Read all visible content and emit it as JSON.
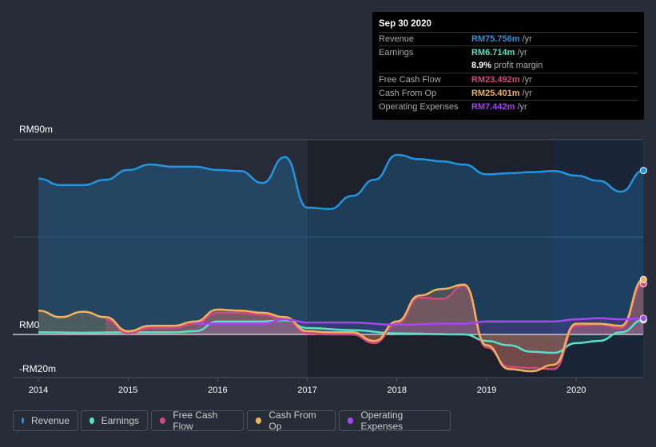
{
  "tooltip": {
    "date": "Sep 30 2020",
    "rows": [
      {
        "label": "Revenue",
        "value": "RM75.756m",
        "unit": "/yr",
        "color": "#2394df"
      },
      {
        "label": "Earnings",
        "value": "RM6.714m",
        "unit": "/yr",
        "color": "#58e0c5"
      },
      {
        "label": "",
        "value": "8.9%",
        "unit": "profit margin",
        "color": "#ffffff"
      },
      {
        "label": "Free Cash Flow",
        "value": "RM23.492m",
        "unit": "/yr",
        "color": "#d2487e"
      },
      {
        "label": "Cash From Op",
        "value": "RM25.401m",
        "unit": "/yr",
        "color": "#f2b25c"
      },
      {
        "label": "Operating Expenses",
        "value": "RM7.442m",
        "unit": "/yr",
        "color": "#a546f0"
      }
    ]
  },
  "chart_data": {
    "type": "line",
    "ylim": [
      -20,
      90
    ],
    "xlim": [
      2013.7,
      2020.75
    ],
    "y_tick_labels": [
      "RM90m",
      "RM0",
      "-RM20m"
    ],
    "x_tick_labels": [
      "2014",
      "2015",
      "2016",
      "2017",
      "2018",
      "2019",
      "2020"
    ],
    "x_ticks": [
      2014,
      2015,
      2016,
      2017,
      2018,
      2019,
      2020
    ],
    "grid": true,
    "legend_position": "bottom-left",
    "series": [
      {
        "name": "Revenue",
        "color": "#2394df",
        "x": [
          2014,
          2014.25,
          2014.5,
          2014.75,
          2015,
          2015.25,
          2015.5,
          2015.75,
          2016,
          2016.25,
          2016.5,
          2016.75,
          2017,
          2017.25,
          2017.5,
          2017.75,
          2018,
          2018.25,
          2018.5,
          2018.75,
          2019,
          2019.25,
          2019.5,
          2019.75,
          2020,
          2020.25,
          2020.5,
          2020.75
        ],
        "values": [
          72,
          69,
          69,
          71.5,
          76,
          78.5,
          77.5,
          77.5,
          76,
          75.5,
          70,
          82,
          58.6,
          58,
          64,
          71.5,
          83,
          81,
          80,
          78.5,
          74,
          74.5,
          75,
          75.5,
          73.4,
          71,
          66,
          75.756
        ]
      },
      {
        "name": "Earnings",
        "color": "#58e0c5",
        "x": [
          2014,
          2014.5,
          2015,
          2015.5,
          2015.75,
          2016,
          2016.5,
          2016.75,
          2017,
          2017.5,
          2018,
          2018.75,
          2019,
          2019.25,
          2019.5,
          2019.75,
          2020,
          2020.25,
          2020.5,
          2020.75
        ],
        "values": [
          1,
          0.8,
          1,
          1,
          1.5,
          6,
          6,
          6.5,
          3,
          2,
          0.5,
          0,
          -3,
          -5,
          -8,
          -8.5,
          -4,
          -3,
          1,
          6.714
        ]
      },
      {
        "name": "Free Cash Flow",
        "color": "#d2487e",
        "x": [
          2014.75,
          2015,
          2015.25,
          2015.5,
          2015.75,
          2016,
          2016.25,
          2016.5,
          2016.75,
          2017,
          2017.25,
          2017.5,
          2017.75,
          2018,
          2018.25,
          2018.5,
          2018.75,
          2019,
          2019.25,
          2019.5,
          2019.75,
          2020,
          2020.25,
          2020.5,
          2020.75
        ],
        "values": [
          7,
          0.5,
          3,
          3,
          5,
          10,
          10,
          9,
          7,
          0.5,
          0,
          0,
          -4,
          5,
          17,
          16.5,
          22.5,
          -6,
          -15,
          -15.5,
          -16,
          4,
          4.5,
          3,
          23.492
        ]
      },
      {
        "name": "Cash From Op",
        "color": "#f2b25c",
        "x": [
          2014,
          2014.25,
          2014.5,
          2014.75,
          2015,
          2015.25,
          2015.5,
          2015.75,
          2016,
          2016.25,
          2016.5,
          2016.75,
          2017,
          2017.25,
          2017.5,
          2017.75,
          2018,
          2018.25,
          2018.5,
          2018.75,
          2019,
          2019.25,
          2019.5,
          2019.75,
          2020,
          2020.25,
          2020.5,
          2020.75
        ],
        "values": [
          11,
          8,
          10.5,
          8,
          1.5,
          4,
          4,
          6,
          11.5,
          11,
          10,
          8,
          1.5,
          1,
          1,
          -3,
          6,
          18,
          21,
          23,
          -5,
          -16,
          -17,
          -14,
          5,
          5,
          4,
          25.401
        ]
      },
      {
        "name": "Operating Expenses",
        "color": "#a546f0",
        "x": [
          2015.75,
          2016,
          2016.5,
          2016.75,
          2017,
          2017.5,
          2018,
          2018.5,
          2018.75,
          2019,
          2019.5,
          2019.75,
          2020,
          2020.25,
          2020.5,
          2020.75
        ],
        "values": [
          5,
          5,
          5,
          7,
          5.5,
          5.5,
          4.5,
          5,
          5,
          6,
          6,
          6,
          7,
          7.5,
          7,
          7.442
        ]
      }
    ]
  }
}
